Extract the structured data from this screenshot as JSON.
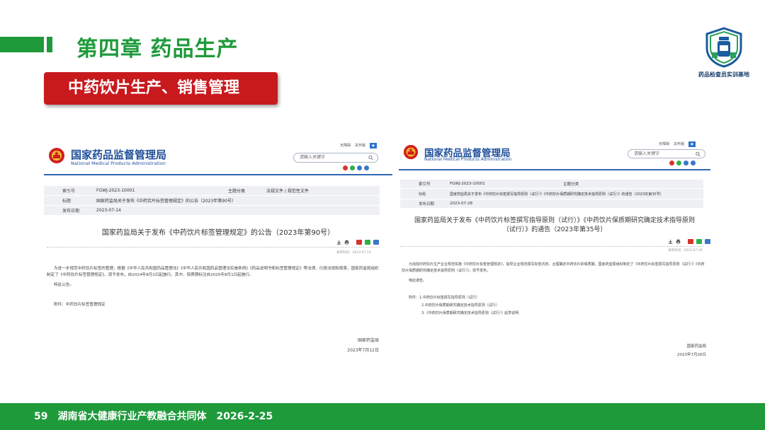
{
  "header": {
    "chapter_title": "第四章  药品生产",
    "logo_caption": "药品检查员实训基地",
    "section_title": "中药饮片生产、销售管理"
  },
  "left_doc": {
    "site_name": "国家药品监督管理局",
    "site_en": "National Medical Products Administration",
    "top_links": [
      "无障碍",
      "关怀版"
    ],
    "search_placeholder": "请输入关键字",
    "meta": {
      "index_label": "索引号",
      "index_value": "FGWJ-2023-10001",
      "category_label": "主题分类",
      "category_value": "法规文件 / 规范性文件",
      "title_label": "标题",
      "title_value": "国家药监局关于发布《中药饮片标签管理规定》的公告（2023年第90号）",
      "date_label": "发布日期",
      "date_value": "2023-07-14"
    },
    "doc_title": "国家药监局关于发布《中药饮片标签管理规定》的公告（2023年第90号）",
    "publish_time": "发布时间：2023-07-14",
    "body": [
      "为进一步规范中药饮片标签的管理，根据《中华人民共和国药品管理法》《中华人民共和国药品管理法实施条例》《药品说明书和标签管理规定》等法律、行政法规和规章，国家药监局组织制定了《中药饮片标签管理规定》，现予发布，自2024年8月1日起施行。其中，保质期标注自2025年8月1日起施行。",
      "特此公告。"
    ],
    "attachment": "附件：中药饮片标签管理规定",
    "sign_org": "国家药监局",
    "sign_date": "2023年7月12日"
  },
  "right_doc": {
    "site_name": "国家药品监督管理局",
    "site_en": "National Medical Products Administration",
    "top_links": [
      "无障碍",
      "关怀版"
    ],
    "search_placeholder": "请输入关键字",
    "meta": {
      "index_label": "索引号",
      "index_value": "FGWJ-2023-10001",
      "category_label": "主题分类",
      "category_value": "",
      "title_label": "标题",
      "title_value": "国家药监局关于发布《中药饮片标签撰写指导原则（试行）》《中药饮片保质期研究确定技术指导原则（试行）》的通告（2023年第35号）",
      "date_label": "发布日期",
      "date_value": "2023-07-28"
    },
    "doc_title_line1": "国家药监局关于发布《中药饮片标签撰写指导原则（试行）》《中药饮片保质期研究确定技术指导原则",
    "doc_title_line2": "（试行）》的通告（2023年第35号）",
    "publish_time": "发布时间：2023-07-28",
    "body": [
      "为加强中药饮片生产企业规范实施《中药饮片标签管理规定》，指导企业规范撰写标签内容、合理确定中药饮片的保质期，国家药监局组织制定了《中药饮片标签撰写指导原则（试行）》《中药饮片保质期研究确定技术指导原则（试行）》，现予发布。",
      "特此通告。"
    ],
    "attachments": [
      "附件：1.中药饮片标签撰写指导原则（试行）",
      "2.中药饮片保质期研究确定技术指导原则（试行）",
      "3.《中药饮片保质期研究确定技术指导原则（试行）》起草说明"
    ],
    "sign_org": "国家药监局",
    "sign_date": "2023年7月26日"
  },
  "footer": {
    "page_number": "59",
    "org": "湖南省大健康行业产教融合共同体",
    "date": "2026-2-25"
  },
  "colors": {
    "brand_green": "#1e9a3a",
    "title_red": "#c8191d",
    "nmpa_blue": "#1f4f9a"
  }
}
